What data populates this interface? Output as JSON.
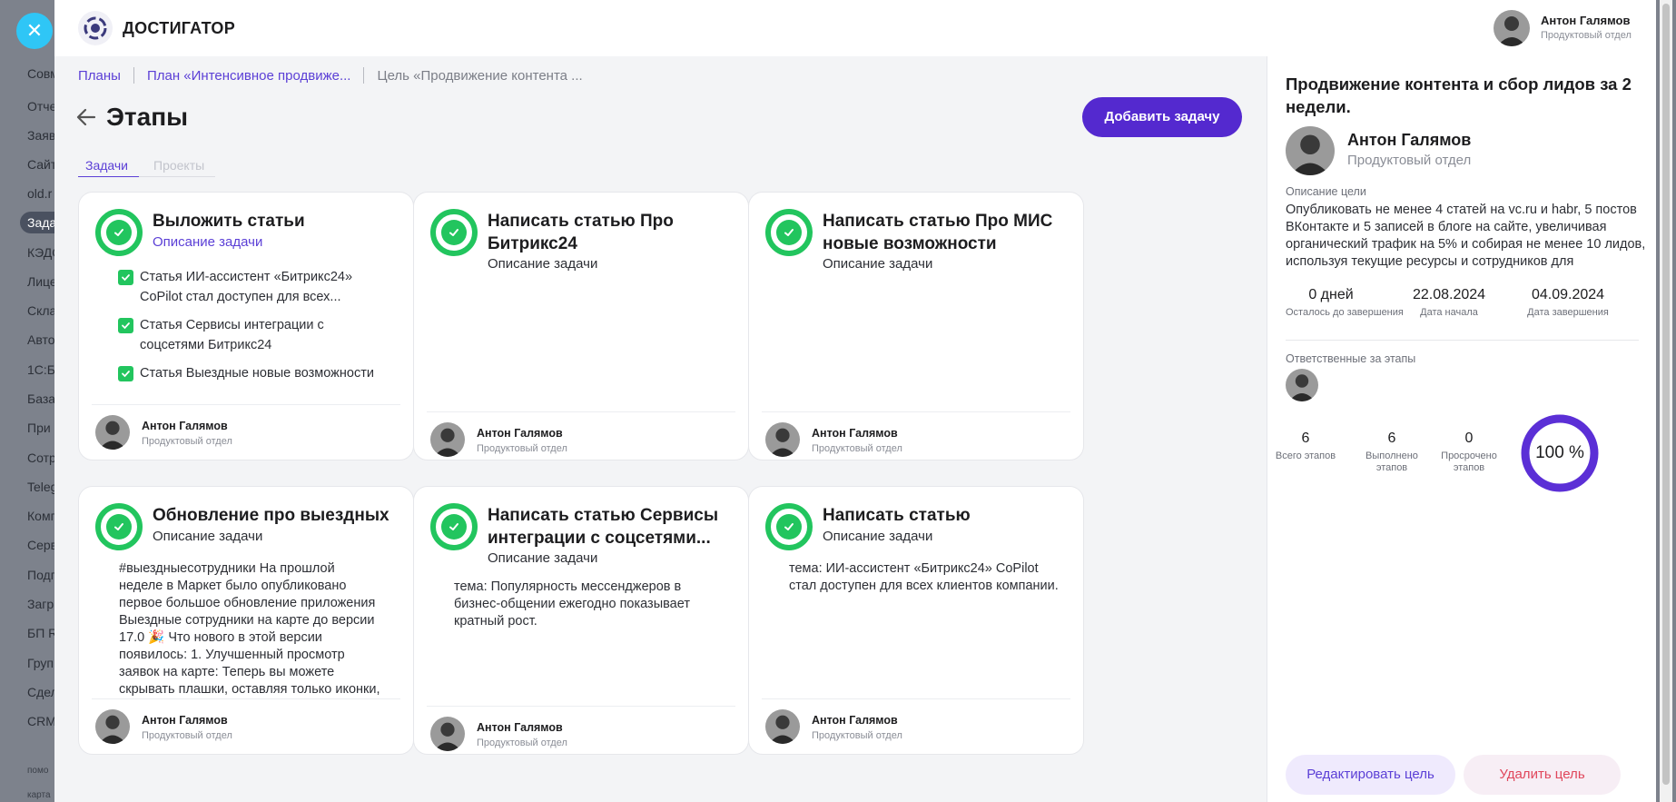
{
  "background_sidebar": {
    "items": [
      "Совм",
      "Отче",
      "Заяв",
      "Сайт",
      "old.r",
      "Зада",
      "КЭДО",
      "Лице",
      "Скла",
      "Авто",
      "1С:Б",
      "База",
      "При",
      "Сотр",
      "Teleg",
      "Комп",
      "Серв",
      "Подп",
      "Загр",
      "БП R",
      "Груп",
      "Сдел",
      "CRM"
    ],
    "footer_items": [
      "помо",
      "карта"
    ],
    "close_icon": "✕"
  },
  "header": {
    "app_title": "ДОСТИГАТОР",
    "user": {
      "name": "Антон Галямов",
      "dept": "Продуктовый отдел"
    }
  },
  "breadcrumb": [
    "Планы",
    "План «Интенсивное продвиже...",
    "Цель «Продвижение контента ..."
  ],
  "page": {
    "title": "Этапы",
    "add_task_label": "Добавить задачу",
    "tabs": [
      "Задачи",
      "Проекты"
    ]
  },
  "cards": [
    {
      "title": "Выложить статьи",
      "desc": "Описание задачи",
      "desc_is_link": true,
      "checklist": [
        "Статья ИИ-ассистент «Битрикс24» CoPilot стал доступен для всех...",
        "Статья Сервисы интеграции с соцсетями Битрикс24",
        "Статья Выездные новые возможности"
      ],
      "body": "",
      "user": {
        "name": "Антон Галямов",
        "dept": "Продуктовый отдел"
      }
    },
    {
      "title": "Написать статью Про Битрикс24",
      "desc": "Описание задачи",
      "body": "",
      "user": {
        "name": "Антон Галямов",
        "dept": "Продуктовый отдел"
      }
    },
    {
      "title": "Написать статью Про МИС новые возможности",
      "desc": "Описание задачи",
      "body": "",
      "user": {
        "name": "Антон Галямов",
        "dept": "Продуктовый отдел"
      }
    },
    {
      "title": "Обновление про выездных",
      "desc": "Описание задачи",
      "body": "#выездныесотрудники На прошлой неделе в Маркет было опубликовано первое большое обновление приложения Выездные сотрудники на карте до версии 17.0 🎉 Что нового в этой версии появилось: 1. Улучшенный просмотр заявок на карте: Теперь вы можете скрывать плашки, оставляя только иконки, что делает просмотр",
      "user": {
        "name": "Антон Галямов",
        "dept": "Продуктовый отдел"
      }
    },
    {
      "title": "Написать статью Сервисы интеграции с соцсетями...",
      "desc": "Описание задачи",
      "body": "тема: Популярность мессенджеров в бизнес-общении ежегодно показывает кратный рост.",
      "user": {
        "name": "Антон Галямов",
        "dept": "Продуктовый отдел"
      }
    },
    {
      "title": "Написать статью",
      "desc": "Описание задачи",
      "body": "тема: ИИ-ассистент «Битрикс24» CoPilot стал доступен для всех клиентов компании.",
      "user": {
        "name": "Антон Галямов",
        "dept": "Продуктовый отдел"
      }
    }
  ],
  "goal": {
    "title": "Продвижение контента и сбор лидов за 2 недели.",
    "owner": {
      "name": "Антон Галямов",
      "dept": "Продуктовый отдел"
    },
    "desc_label": "Описание цели",
    "desc": "Опубликовать не менее 4 статей на vc.ru и habr, 5 постов ВКонтакте и 5 записей в блоге на сайте, увеличивая органический трафик на 5% и собирая не менее 10 лидов, используя текущие ресурсы и сотрудников для",
    "stats": [
      {
        "value": "0 дней",
        "label": "Осталось до завершения"
      },
      {
        "value": "22.08.2024",
        "label": "Дата начала"
      },
      {
        "value": "04.09.2024",
        "label": "Дата завершения"
      }
    ],
    "responsible_label": "Ответственные за этапы",
    "stage_stats": [
      {
        "value": "6",
        "label": "Всего этапов"
      },
      {
        "value": "6",
        "label": "Выполнено этапов"
      },
      {
        "value": "0",
        "label": "Просрочено этапов"
      }
    ],
    "progress_text": "100 %",
    "progress_value": 1.0,
    "edit_label": "Редактировать цель",
    "delete_label": "Удалить цель"
  },
  "colors": {
    "accent": "#5429cf",
    "link": "#5b3fd6",
    "success": "#22c55e",
    "danger": "#e0465b",
    "close_button": "#2fc6f6"
  }
}
